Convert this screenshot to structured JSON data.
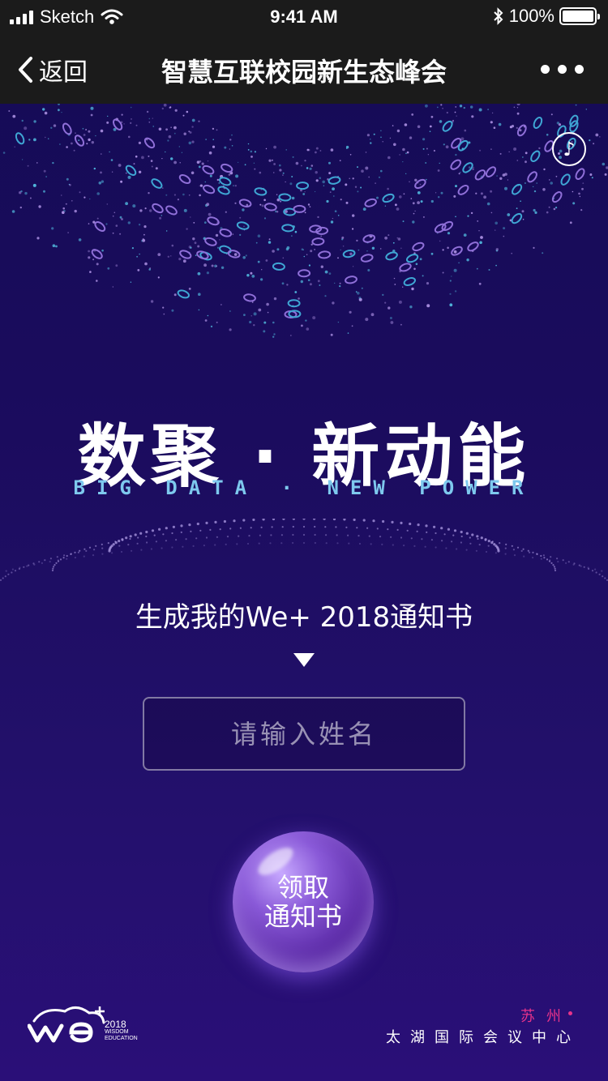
{
  "status_bar": {
    "carrier": "Sketch",
    "time": "9:41 AM",
    "battery": "100%",
    "battery_level": 1.0
  },
  "nav": {
    "back_label": "返回",
    "title": "智慧互联校园新生态峰会"
  },
  "hero": {
    "headline": "数聚 · 新动能",
    "subline": "BIG DATA · NEW POWER"
  },
  "form": {
    "prompt": "生成我的We+ 2018通知书",
    "name_placeholder": "请输入姓名",
    "name_value": "",
    "claim_line1": "领取",
    "claim_line2": "通知书"
  },
  "footer": {
    "year": "2018",
    "tag_line1": "WISDOM",
    "tag_line2": "EDUCATION",
    "city": "苏州",
    "venue": "太湖国际会议中心"
  },
  "colors": {
    "background": "#1b0c5e",
    "bar": "#1b1b1b",
    "accent_cyan": "#7ec9ee",
    "accent_pink": "#e8338a"
  },
  "icons": {
    "music": "music-note-icon",
    "back": "chevron-left-icon",
    "more": "more-dots-icon"
  }
}
